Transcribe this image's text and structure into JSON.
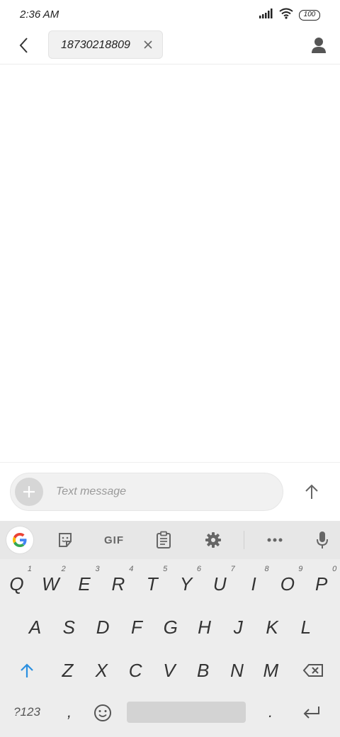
{
  "status_bar": {
    "time": "2:36 AM",
    "battery": "100"
  },
  "header": {
    "recipient": "18730218809"
  },
  "compose": {
    "placeholder": "Text message"
  },
  "keyboard": {
    "toolbar": {
      "gif_label": "GIF"
    },
    "rows": [
      [
        {
          "label": "Q",
          "hint": "1"
        },
        {
          "label": "W",
          "hint": "2"
        },
        {
          "label": "E",
          "hint": "3"
        },
        {
          "label": "R",
          "hint": "4"
        },
        {
          "label": "T",
          "hint": "5"
        },
        {
          "label": "Y",
          "hint": "6"
        },
        {
          "label": "U",
          "hint": "7"
        },
        {
          "label": "I",
          "hint": "8"
        },
        {
          "label": "O",
          "hint": "9"
        },
        {
          "label": "P",
          "hint": "0"
        }
      ],
      [
        {
          "label": "A"
        },
        {
          "label": "S"
        },
        {
          "label": "D"
        },
        {
          "label": "F"
        },
        {
          "label": "G"
        },
        {
          "label": "H"
        },
        {
          "label": "J"
        },
        {
          "label": "K"
        },
        {
          "label": "L"
        }
      ],
      [
        {
          "label": "Z"
        },
        {
          "label": "X"
        },
        {
          "label": "C"
        },
        {
          "label": "V"
        },
        {
          "label": "B"
        },
        {
          "label": "N"
        },
        {
          "label": "M"
        }
      ]
    ],
    "symbols_key": "?123",
    "comma_key": ",",
    "period_key": "."
  },
  "colors": {
    "accent": "#2a8fe0",
    "keyboard_bg": "#ededed"
  }
}
